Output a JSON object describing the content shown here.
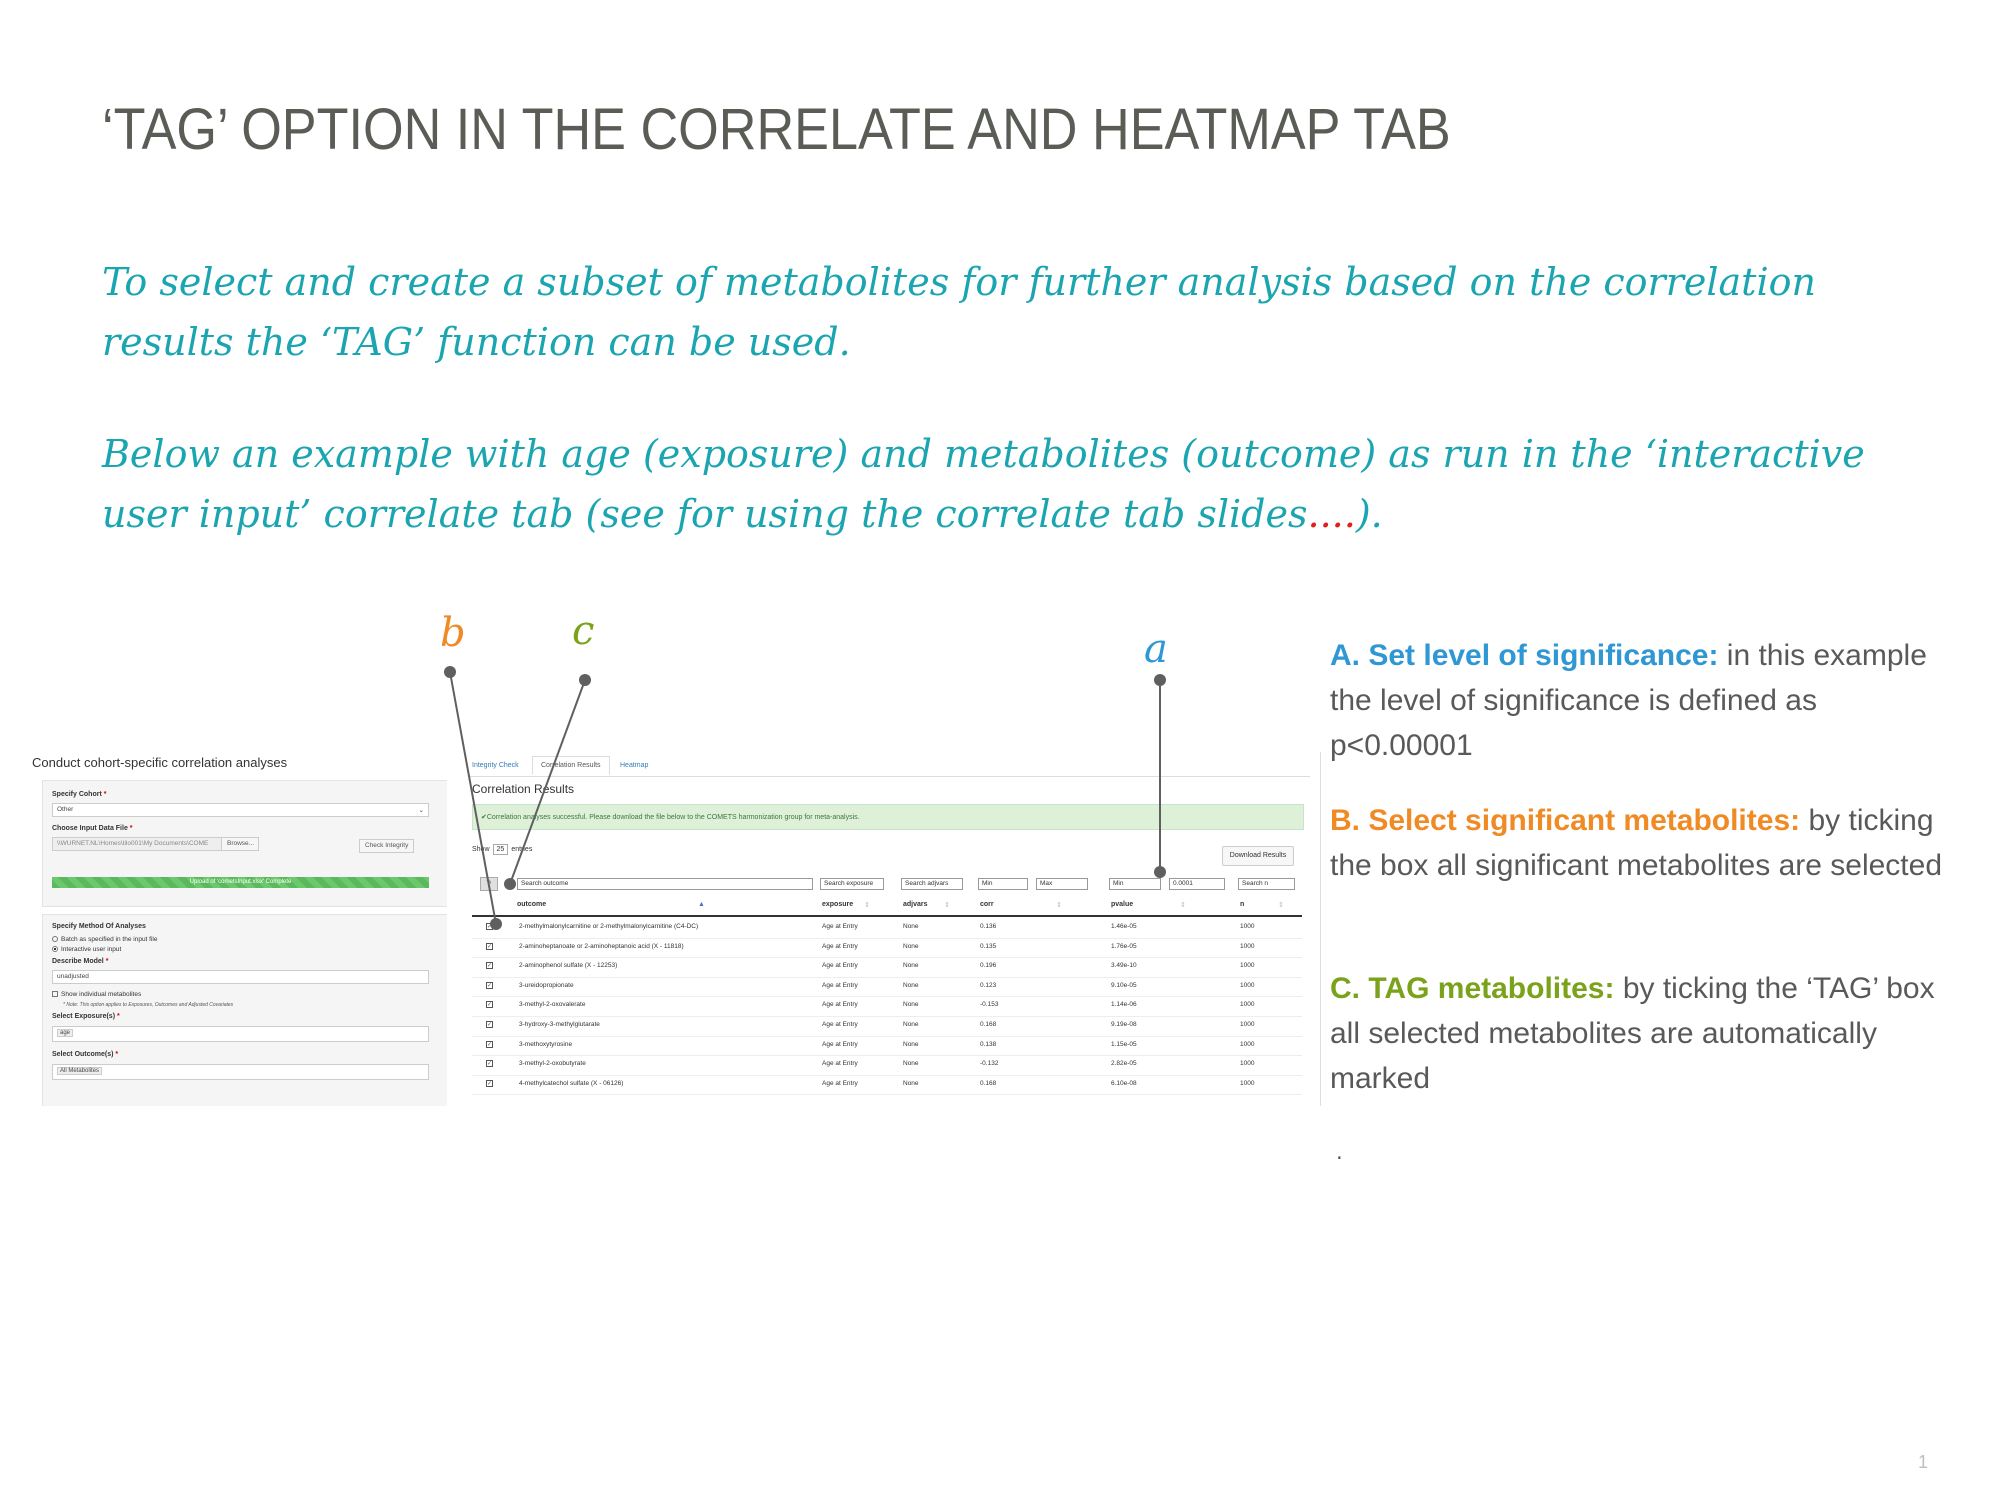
{
  "slide": {
    "title": "‘TAG’ OPTION IN THE CORRELATE  AND HEATMAP TAB",
    "intro1": "To select and create a subset of metabolites for further analysis based on the correlation results the ‘TAG’ function can be used.",
    "intro2_main": "Below an example with age (exposure) and metabolites (outcome) as run in the ‘interactive user input’ correlate tab (see for using the correlate tab slides",
    "intro2_dots": "....",
    "intro2_end": ").",
    "callouts": {
      "a": "a",
      "b": "b",
      "c": "c"
    },
    "colors": {
      "a": "#2f97d3",
      "b": "#f08a24",
      "c": "#7aa21a",
      "intro": "#1aa5b0",
      "title": "#5a5d55"
    },
    "page_number": "1",
    "trailing_dot": "."
  },
  "descriptions": [
    {
      "key": "A",
      "head": "A. Set level of significance:",
      "body": " in this example the level of significance is defined as p<0.00001"
    },
    {
      "key": "B",
      "head": "B. Select significant metabolites:",
      "body": " by ticking the box all significant metabolites are selected"
    },
    {
      "key": "C",
      "head": "C. TAG metabolites:",
      "body": " by ticking the ‘TAG’ box all selected metabolites are automatically marked"
    }
  ],
  "left_panel": {
    "heading": "Conduct cohort-specific correlation analyses",
    "specify_cohort_label": "Specify Cohort",
    "cohort_value": "Other",
    "input_file_label": "Choose Input Data File",
    "input_file_value": "\\\\WURNET.NL\\Homes\\tilo001\\My Documents\\COME",
    "browse_label": "Browse...",
    "check_integrity_label": "Check Integrity",
    "upload_status": "Upload of 'cometsInput.xlsx' Complete",
    "method_label": "Specify Method Of Analyses",
    "method_options": [
      "Batch as specified in the input file",
      "Interactive user input"
    ],
    "describe_model_label": "Describe Model",
    "model_value": "unadjusted",
    "show_individual_label": "Show individual metabolites",
    "note": "* Note: This option applies to Exposures, Outcomes and Adjusted Covariates",
    "exposure_label": "Select Exposure(s)",
    "exposure_value": "age",
    "outcome_label": "Select Outcome(s)",
    "outcome_value": "All Metabolites",
    "required_mark": "*"
  },
  "right_panel": {
    "tabs": [
      "Integrity Check",
      "Correlation Results",
      "Heatmap"
    ],
    "title": "Correlation Results",
    "alert": "✔Correlation analyses successful. Please download the file below to the COMETS harmonization group for meta-analysis.",
    "show_label": "Show",
    "show_value": "25",
    "entries_label": "entries",
    "download_label": "Download Results",
    "filters": {
      "outcome": "Search outcome",
      "exposure": "Search exposure",
      "adjvars": "Search adjvars",
      "corr_min": "Min",
      "corr_max": "Max",
      "pvalue_min": "Min",
      "pvalue_max": "0.0001",
      "n": "Search n"
    },
    "tag_icon": "✎",
    "columns": [
      "outcome",
      "exposure",
      "adjvars",
      "corr",
      "pvalue",
      "n"
    ],
    "rows": [
      {
        "outcome": "2-methylmalonylcarnitine or 2-methylmalonylcarnitine (C4-DC)",
        "exposure": "Age at Entry",
        "adjvars": "None",
        "corr": "0.136",
        "pvalue": "1.46e-05",
        "n": "1000"
      },
      {
        "outcome": "2-aminoheptanoate or 2-aminoheptanoic acid (X - 11818)",
        "exposure": "Age at Entry",
        "adjvars": "None",
        "corr": "0.135",
        "pvalue": "1.76e-05",
        "n": "1000"
      },
      {
        "outcome": "2-aminophenol sulfate (X - 12253)",
        "exposure": "Age at Entry",
        "adjvars": "None",
        "corr": "0.196",
        "pvalue": "3.49e-10",
        "n": "1000"
      },
      {
        "outcome": "3-ureidopropionate",
        "exposure": "Age at Entry",
        "adjvars": "None",
        "corr": "0.123",
        "pvalue": "9.10e-05",
        "n": "1000"
      },
      {
        "outcome": "3-methyl-2-oxovalerate",
        "exposure": "Age at Entry",
        "adjvars": "None",
        "corr": "-0.153",
        "pvalue": "1.14e-06",
        "n": "1000"
      },
      {
        "outcome": "3-hydroxy-3-methylglutarate",
        "exposure": "Age at Entry",
        "adjvars": "None",
        "corr": "0.168",
        "pvalue": "9.19e-08",
        "n": "1000"
      },
      {
        "outcome": "3-methoxytyrosine",
        "exposure": "Age at Entry",
        "adjvars": "None",
        "corr": "0.138",
        "pvalue": "1.15e-05",
        "n": "1000"
      },
      {
        "outcome": "3-methyl-2-oxobutyrate",
        "exposure": "Age at Entry",
        "adjvars": "None",
        "corr": "-0.132",
        "pvalue": "2.82e-05",
        "n": "1000"
      },
      {
        "outcome": "4-methylcatechol sulfate (X - 06126)",
        "exposure": "Age at Entry",
        "adjvars": "None",
        "corr": "0.168",
        "pvalue": "6.10e-08",
        "n": "1000"
      }
    ]
  }
}
